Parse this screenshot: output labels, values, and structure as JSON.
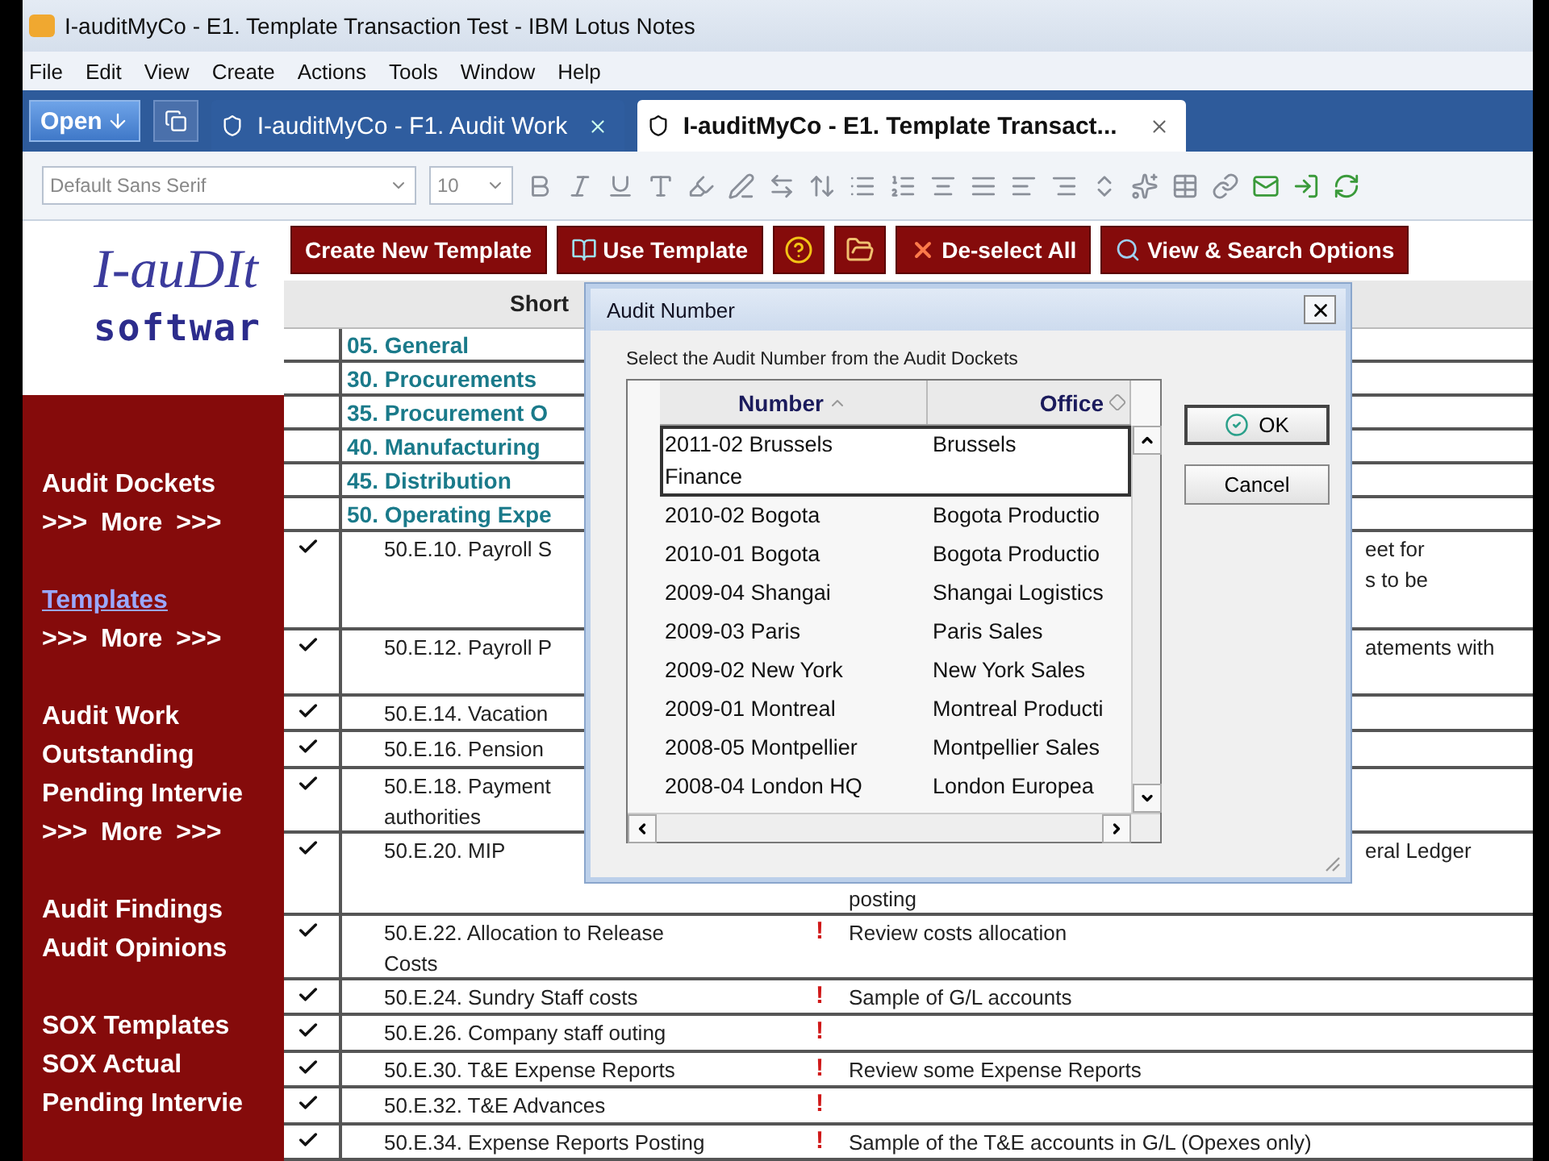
{
  "window": {
    "title": "I-auditMyCo - E1. Template Transaction Test - IBM Lotus Notes"
  },
  "menu": [
    "File",
    "Edit",
    "View",
    "Create",
    "Actions",
    "Tools",
    "Window",
    "Help"
  ],
  "tab_bar": {
    "open_button": "Open",
    "tabs": [
      {
        "label": "I-auditMyCo - F1. Audit Work",
        "selected": false
      },
      {
        "label": "I-auditMyCo - E1. Template Transact...",
        "selected": true
      }
    ]
  },
  "toolbar": {
    "font": "Default Sans Serif",
    "size": "10"
  },
  "sidebar": {
    "logo": {
      "line_1": "I-auDIt",
      "line_2": "softwar"
    },
    "groups": [
      {
        "items": [
          {
            "kind": "link",
            "label": "Audit Dockets",
            "selected": false
          },
          {
            "kind": "more",
            "label": ">>> More >>>",
            "selected": false
          }
        ]
      },
      {
        "items": [
          {
            "kind": "link",
            "label": "Templates",
            "selected": true
          },
          {
            "kind": "more",
            "label": ">>> More >>>",
            "selected": false
          }
        ]
      },
      {
        "items": [
          {
            "kind": "link",
            "label": "Audit Work",
            "selected": false
          },
          {
            "kind": "link",
            "label": "Outstanding",
            "selected": false
          },
          {
            "kind": "link",
            "label": "Pending Intervie",
            "selected": false
          },
          {
            "kind": "more",
            "label": ">>> More >>>",
            "selected": false
          }
        ]
      },
      {
        "items": [
          {
            "kind": "link",
            "label": "Audit Findings",
            "selected": false
          },
          {
            "kind": "link",
            "label": "Audit Opinions",
            "selected": false
          }
        ]
      },
      {
        "items": [
          {
            "kind": "link",
            "label": "SOX Templates",
            "selected": false
          },
          {
            "kind": "link",
            "label": "SOX Actual",
            "selected": false
          },
          {
            "kind": "link",
            "label": "Pending Intervie",
            "selected": false
          }
        ]
      }
    ]
  },
  "actions": [
    {
      "kind": "plain",
      "label": "Create New Template"
    },
    {
      "kind": "template",
      "label": "Use Template"
    },
    {
      "kind": "help"
    },
    {
      "kind": "folder"
    },
    {
      "kind": "deselect",
      "label": "De-select All"
    },
    {
      "kind": "view",
      "label": "View & Search Options"
    }
  ],
  "view": {
    "columns": [
      "Short"
    ],
    "rows": [
      {
        "kind": "category",
        "label": "05. General"
      },
      {
        "kind": "category",
        "label": "30. Procurements"
      },
      {
        "kind": "category",
        "label": "35. Procurement O"
      },
      {
        "kind": "category",
        "label": "40. Manufacturing"
      },
      {
        "kind": "category",
        "label": "45. Distribution"
      },
      {
        "kind": "category",
        "label": "50. Operating Expe"
      },
      {
        "kind": "document",
        "checked": true,
        "short": [
          "50.E.10. Payroll S"
        ],
        "desc_tail": [
          "eet for",
          "s to be"
        ]
      },
      {
        "kind": "document",
        "checked": true,
        "short": [
          "50.E.12. Payroll P"
        ],
        "desc_tail": [
          "atements with"
        ]
      },
      {
        "kind": "document",
        "checked": true,
        "short": [
          "50.E.14. Vacation"
        ]
      },
      {
        "kind": "document",
        "checked": true,
        "short": [
          "50.E.16. Pension"
        ]
      },
      {
        "kind": "document",
        "checked": true,
        "short": [
          "50.E.18. Payment",
          "authorities"
        ]
      },
      {
        "kind": "document",
        "checked": true,
        "short": [
          "50.E.20. MIP"
        ],
        "desc_tail": [
          "eral Ledger"
        ],
        "desc_below": "posting"
      },
      {
        "kind": "document",
        "checked": true,
        "short": [
          "50.E.22. Allocation to Release",
          "Costs"
        ],
        "flag": "!",
        "desc": "Review costs allocation"
      },
      {
        "kind": "document",
        "checked": true,
        "short": [
          "50.E.24. Sundry Staff costs"
        ],
        "flag": "!",
        "desc": "Sample of G/L accounts"
      },
      {
        "kind": "document",
        "checked": true,
        "short": [
          "50.E.26. Company staff outing"
        ],
        "flag": "!"
      },
      {
        "kind": "document",
        "checked": true,
        "short": [
          "50.E.30. T&E Expense Reports"
        ],
        "flag": "!",
        "desc": "Review some Expense Reports"
      },
      {
        "kind": "document",
        "checked": true,
        "short": [
          "50.E.32. T&E Advances"
        ],
        "flag": "!"
      },
      {
        "kind": "document",
        "checked": true,
        "short": [
          "50.E.34. Expense Reports Posting"
        ],
        "flag": "!",
        "desc": "Sample of the T&E accounts in G/L (Opexes only)"
      }
    ]
  },
  "dialog": {
    "title": "Audit Number",
    "prompt": "Select the Audit Number from the Audit Dockets",
    "columns": [
      {
        "label": "Number",
        "sorted": true
      },
      {
        "label": "Office",
        "sorted": false
      }
    ],
    "rows": [
      {
        "number": "2011-02 Brussels Finance",
        "office": "Brussels",
        "selected": true
      },
      {
        "number": "2010-02 Bogota",
        "office": "Bogota Productio",
        "selected": false
      },
      {
        "number": "2010-01 Bogota",
        "office": "Bogota Productio",
        "selected": false
      },
      {
        "number": "2009-04 Shangai",
        "office": "Shangai Logistics",
        "selected": false
      },
      {
        "number": "2009-03 Paris",
        "office": "Paris Sales",
        "selected": false
      },
      {
        "number": "2009-02 New York",
        "office": "New York Sales",
        "selected": false
      },
      {
        "number": "2009-01 Montreal",
        "office": "Montreal Producti",
        "selected": false
      },
      {
        "number": "2008-05 Montpellier",
        "office": "Montpellier Sales",
        "selected": false
      },
      {
        "number": "2008-04 London HQ",
        "office": "London Europea",
        "selected": false
      }
    ],
    "buttons": [
      {
        "label": "OK",
        "default": true
      },
      {
        "label": "Cancel",
        "default": false
      }
    ]
  }
}
